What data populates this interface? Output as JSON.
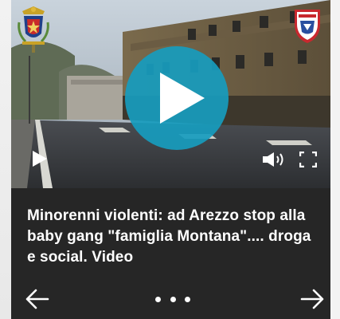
{
  "article": {
    "title": "Minorenni violenti: ad Arezzo stop alla baby gang \"famiglia Montana\".... droga e social. Video"
  },
  "video": {
    "overlay_icons": [
      "polizia-di-stato-emblem",
      "polizia-municipale-badge"
    ],
    "controls": [
      "play-icon",
      "volume-icon",
      "fullscreen-icon"
    ],
    "accent_color": "#179cbe"
  },
  "carousel": {
    "icons": [
      "arrow-left-icon",
      "arrow-right-icon"
    ],
    "dot_count": 3
  },
  "colors": {
    "card_background": "#262626",
    "text": "#ffffff"
  }
}
